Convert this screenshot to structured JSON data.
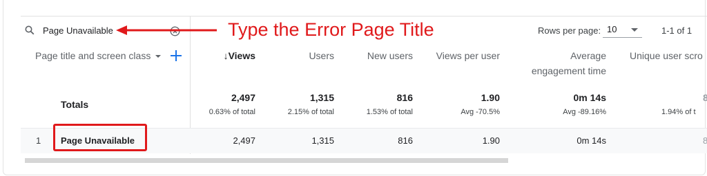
{
  "search": {
    "value": "Page Unavailable"
  },
  "annotation": {
    "text": "Type the Error Page Title",
    "color": "#e0191b"
  },
  "pagination": {
    "rows_label": "Rows per page:",
    "rows_value": "10",
    "range": "1-1 of 1"
  },
  "table": {
    "dimension_header": "Page title and screen class",
    "columns": [
      {
        "label": "↓Views",
        "sorted": true
      },
      {
        "label": "Users"
      },
      {
        "label": "New users"
      },
      {
        "label": "Views per user"
      },
      {
        "label": "Average",
        "label2": "engagement time"
      },
      {
        "label": "Unique user scro"
      }
    ],
    "totals": {
      "label": "Totals",
      "values": [
        "2,497",
        "1,315",
        "816",
        "1.90",
        "0m 14s",
        "8"
      ],
      "subs": [
        "0.63% of total",
        "2.15% of total",
        "1.53% of total",
        "Avg -70.5%",
        "Avg -89.16%",
        "1.94% of t"
      ]
    },
    "rows": [
      {
        "index": "1",
        "title": "Page Unavailable",
        "values": [
          "2,497",
          "1,315",
          "816",
          "1.90",
          "0m 14s",
          "8"
        ]
      }
    ]
  }
}
